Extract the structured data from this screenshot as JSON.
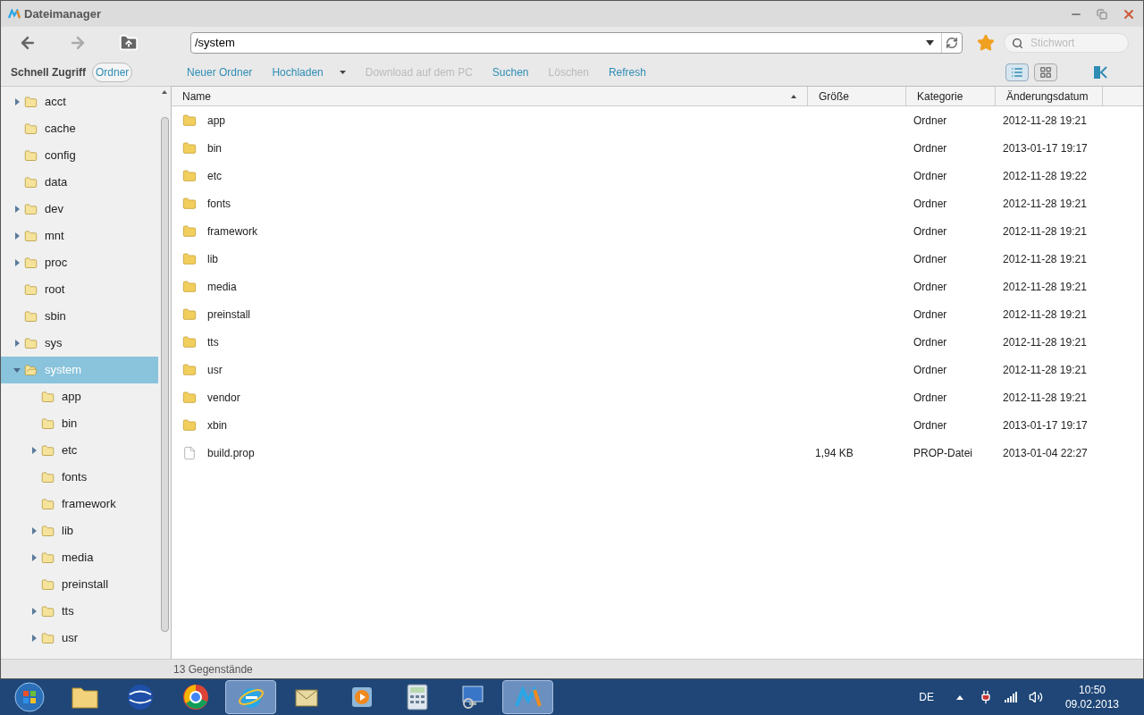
{
  "window": {
    "title": "Dateimanager"
  },
  "path": {
    "value": "/system"
  },
  "search": {
    "placeholder": "Stichwort"
  },
  "sidebar_tabs": [
    {
      "label": "Schnell Zugriff",
      "selected": false
    },
    {
      "label": "Ordner",
      "selected": true
    }
  ],
  "actions": [
    {
      "label": "Neuer Ordner",
      "disabled": false,
      "dropdown": false
    },
    {
      "label": "Hochladen",
      "disabled": false,
      "dropdown": true
    },
    {
      "label": "Download auf dem PC",
      "disabled": true,
      "dropdown": false
    },
    {
      "label": "Suchen",
      "disabled": false,
      "dropdown": false
    },
    {
      "label": "Löschen",
      "disabled": true,
      "dropdown": false
    },
    {
      "label": "Refresh",
      "disabled": false,
      "dropdown": false
    }
  ],
  "views": [
    {
      "kind": "list",
      "selected": true
    },
    {
      "kind": "grid",
      "selected": false
    }
  ],
  "tree": [
    {
      "label": "acct",
      "expandable": true,
      "expanded": false,
      "selected": false
    },
    {
      "label": "cache",
      "expandable": false,
      "expanded": false,
      "selected": false
    },
    {
      "label": "config",
      "expandable": false,
      "expanded": false,
      "selected": false
    },
    {
      "label": "data",
      "expandable": false,
      "expanded": false,
      "selected": false
    },
    {
      "label": "dev",
      "expandable": true,
      "expanded": false,
      "selected": false
    },
    {
      "label": "mnt",
      "expandable": true,
      "expanded": false,
      "selected": false
    },
    {
      "label": "proc",
      "expandable": true,
      "expanded": false,
      "selected": false
    },
    {
      "label": "root",
      "expandable": false,
      "expanded": false,
      "selected": false
    },
    {
      "label": "sbin",
      "expandable": false,
      "expanded": false,
      "selected": false
    },
    {
      "label": "sys",
      "expandable": true,
      "expanded": false,
      "selected": false
    },
    {
      "label": "system",
      "expandable": true,
      "expanded": true,
      "selected": true,
      "children": [
        {
          "label": "app",
          "expandable": false,
          "expanded": false,
          "selected": false
        },
        {
          "label": "bin",
          "expandable": false,
          "expanded": false,
          "selected": false
        },
        {
          "label": "etc",
          "expandable": true,
          "expanded": false,
          "selected": false
        },
        {
          "label": "fonts",
          "expandable": false,
          "expanded": false,
          "selected": false
        },
        {
          "label": "framework",
          "expandable": false,
          "expanded": false,
          "selected": false
        },
        {
          "label": "lib",
          "expandable": true,
          "expanded": false,
          "selected": false
        },
        {
          "label": "media",
          "expandable": true,
          "expanded": false,
          "selected": false
        },
        {
          "label": "preinstall",
          "expandable": false,
          "expanded": false,
          "selected": false
        },
        {
          "label": "tts",
          "expandable": true,
          "expanded": false,
          "selected": false
        },
        {
          "label": "usr",
          "expandable": true,
          "expanded": false,
          "selected": false
        }
      ]
    }
  ],
  "table": {
    "columns": [
      "Name",
      "Größe",
      "Kategorie",
      "Änderungsdatum"
    ],
    "rows": [
      {
        "kind": "folder",
        "name": "app",
        "size": "",
        "category": "Ordner",
        "modified": "2012-11-28 19:21"
      },
      {
        "kind": "folder",
        "name": "bin",
        "size": "",
        "category": "Ordner",
        "modified": "2013-01-17 19:17"
      },
      {
        "kind": "folder",
        "name": "etc",
        "size": "",
        "category": "Ordner",
        "modified": "2012-11-28 19:22"
      },
      {
        "kind": "folder",
        "name": "fonts",
        "size": "",
        "category": "Ordner",
        "modified": "2012-11-28 19:21"
      },
      {
        "kind": "folder",
        "name": "framework",
        "size": "",
        "category": "Ordner",
        "modified": "2012-11-28 19:21"
      },
      {
        "kind": "folder",
        "name": "lib",
        "size": "",
        "category": "Ordner",
        "modified": "2012-11-28 19:21"
      },
      {
        "kind": "folder",
        "name": "media",
        "size": "",
        "category": "Ordner",
        "modified": "2012-11-28 19:21"
      },
      {
        "kind": "folder",
        "name": "preinstall",
        "size": "",
        "category": "Ordner",
        "modified": "2012-11-28 19:21"
      },
      {
        "kind": "folder",
        "name": "tts",
        "size": "",
        "category": "Ordner",
        "modified": "2012-11-28 19:21"
      },
      {
        "kind": "folder",
        "name": "usr",
        "size": "",
        "category": "Ordner",
        "modified": "2012-11-28 19:21"
      },
      {
        "kind": "folder",
        "name": "vendor",
        "size": "",
        "category": "Ordner",
        "modified": "2012-11-28 19:21"
      },
      {
        "kind": "folder",
        "name": "xbin",
        "size": "",
        "category": "Ordner",
        "modified": "2013-01-17 19:17"
      },
      {
        "kind": "file",
        "name": "build.prop",
        "size": "1,94 KB",
        "category": "PROP-Datei",
        "modified": "2013-01-04 22:27"
      }
    ]
  },
  "status_bar": {
    "count": "13 Gegenstände"
  },
  "taskbar": {
    "buttons": [
      {
        "active": false
      },
      {
        "active": false
      },
      {
        "active": false
      },
      {
        "active": false
      },
      {
        "active": true
      },
      {
        "active": false
      },
      {
        "active": false
      },
      {
        "active": false
      },
      {
        "active": false
      },
      {
        "active": true
      }
    ],
    "language": "DE",
    "time": "10:50",
    "date": "09.02.2013"
  }
}
